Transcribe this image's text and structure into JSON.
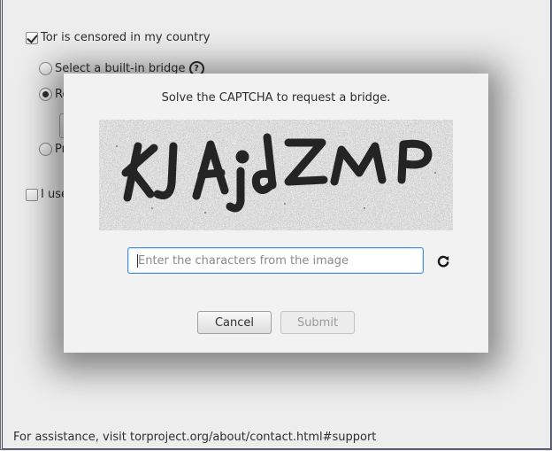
{
  "background": {
    "censored_checkbox": {
      "label": "Tor is censored in my country",
      "checked": true
    },
    "builtin_bridge": {
      "label": "Select a built-in bridge",
      "checked": false
    },
    "request_bridge": {
      "label": "Re",
      "checked": true
    },
    "provide_bridge": {
      "label": "Pr",
      "checked": false
    },
    "proxy_checkbox": {
      "label": "I use",
      "checked": false
    },
    "help_icon": "question-circle-icon",
    "footer": "For assistance, visit torproject.org/about/contact.html#support"
  },
  "dialog": {
    "title": "Solve the CAPTCHA to request a bridge.",
    "captcha_text": "KJAjdZMP",
    "input": {
      "value": "",
      "placeholder": "Enter the characters from the image"
    },
    "reload_icon": "reload-icon",
    "cancel_label": "Cancel",
    "submit_label": "Submit",
    "submit_enabled": false
  },
  "colors": {
    "focus_border": "#4a90d9",
    "window_bg": "#ededed",
    "dialog_bg": "#f2f2f2"
  }
}
